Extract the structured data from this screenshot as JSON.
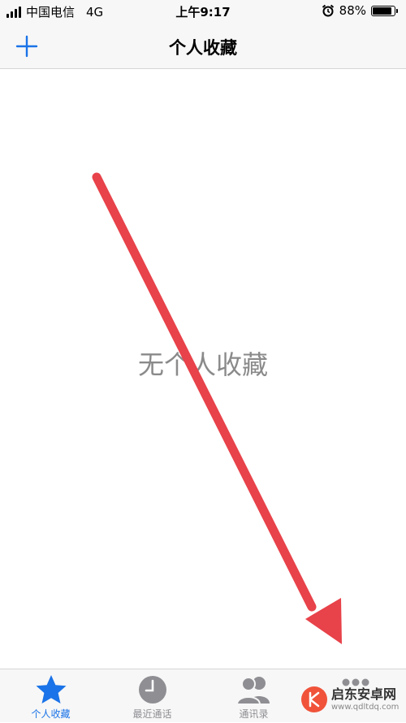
{
  "status_bar": {
    "carrier": "中国电信",
    "network": "4G",
    "time": "上午9:17",
    "battery_percent": "88%",
    "battery_level": 0.88,
    "alarm_icon": "alarm-clock-icon"
  },
  "nav": {
    "title": "个人收藏",
    "add_icon": "plus-icon"
  },
  "main": {
    "empty_message": "无个人收藏"
  },
  "tabs": [
    {
      "label": "个人收藏",
      "icon": "star-icon",
      "active": true
    },
    {
      "label": "最近通话",
      "icon": "clock-icon",
      "active": false
    },
    {
      "label": "通讯录",
      "icon": "contacts-icon",
      "active": false
    },
    {
      "label": "",
      "icon": "keypad-icon",
      "active": false
    }
  ],
  "watermark": {
    "name": "启东安卓网",
    "url": "www.qdltdq.com"
  },
  "colors": {
    "accent": "#1a73e8",
    "arrow": "#e8424a",
    "inactive": "#8e8e93"
  }
}
